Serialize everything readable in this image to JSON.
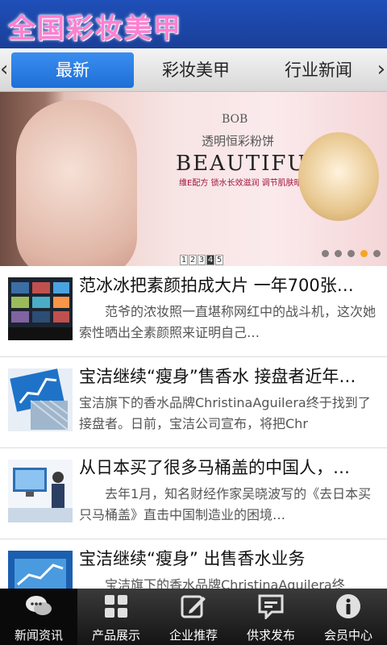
{
  "header": {
    "title": "全国彩妆美甲"
  },
  "tabs": [
    {
      "label": "最新",
      "active": true
    },
    {
      "label": "彩妆美甲",
      "active": false
    },
    {
      "label": "行业新闻",
      "active": false
    }
  ],
  "banner": {
    "brand": "BOB",
    "product": "透明恒彩粉饼",
    "headline": "BEAUTIFUL",
    "tagline": "维E配方 锁水长效滋润 调节肌肤暗哑",
    "pages": [
      "1",
      "2",
      "3",
      "4",
      "5"
    ],
    "current_page": "4"
  },
  "news": [
    {
      "title": "范冰冰把素颜拍成大片 一年700张…",
      "summary": "范爷的浓妆照一直堪称网红中的战斗机，这次她索性晒出全素颜照来证明自己…"
    },
    {
      "title": "宝洁继续“瘦身”售香水 接盘者近年…",
      "summary": "宝洁旗下的香水品牌ChristinaAguilera终于找到了接盘者。日前，宝洁公司宣布，将把Chr"
    },
    {
      "title": "从日本买了很多马桶盖的中国人，…",
      "summary": "去年1月，知名财经作家吴晓波写的《去日本买只马桶盖》直击中国制造业的困境…"
    },
    {
      "title": "宝洁继续“瘦身” 出售香水业务",
      "summary": "宝洁旗下的香水品牌ChristinaAguilera终"
    }
  ],
  "bottom_nav": [
    {
      "label": "新闻资讯",
      "icon": "chat-bubbles-icon",
      "active": true
    },
    {
      "label": "产品展示",
      "icon": "grid-icon",
      "active": false
    },
    {
      "label": "企业推荐",
      "icon": "edit-icon",
      "active": false
    },
    {
      "label": "供求发布",
      "icon": "message-icon",
      "active": false
    },
    {
      "label": "会员中心",
      "icon": "info-icon",
      "active": false
    }
  ],
  "colors": {
    "header_bg": "#1f4fb8",
    "title": "#ff7fd0",
    "tab_active": "#2a7ee3",
    "dot_active": "#f5a623"
  }
}
